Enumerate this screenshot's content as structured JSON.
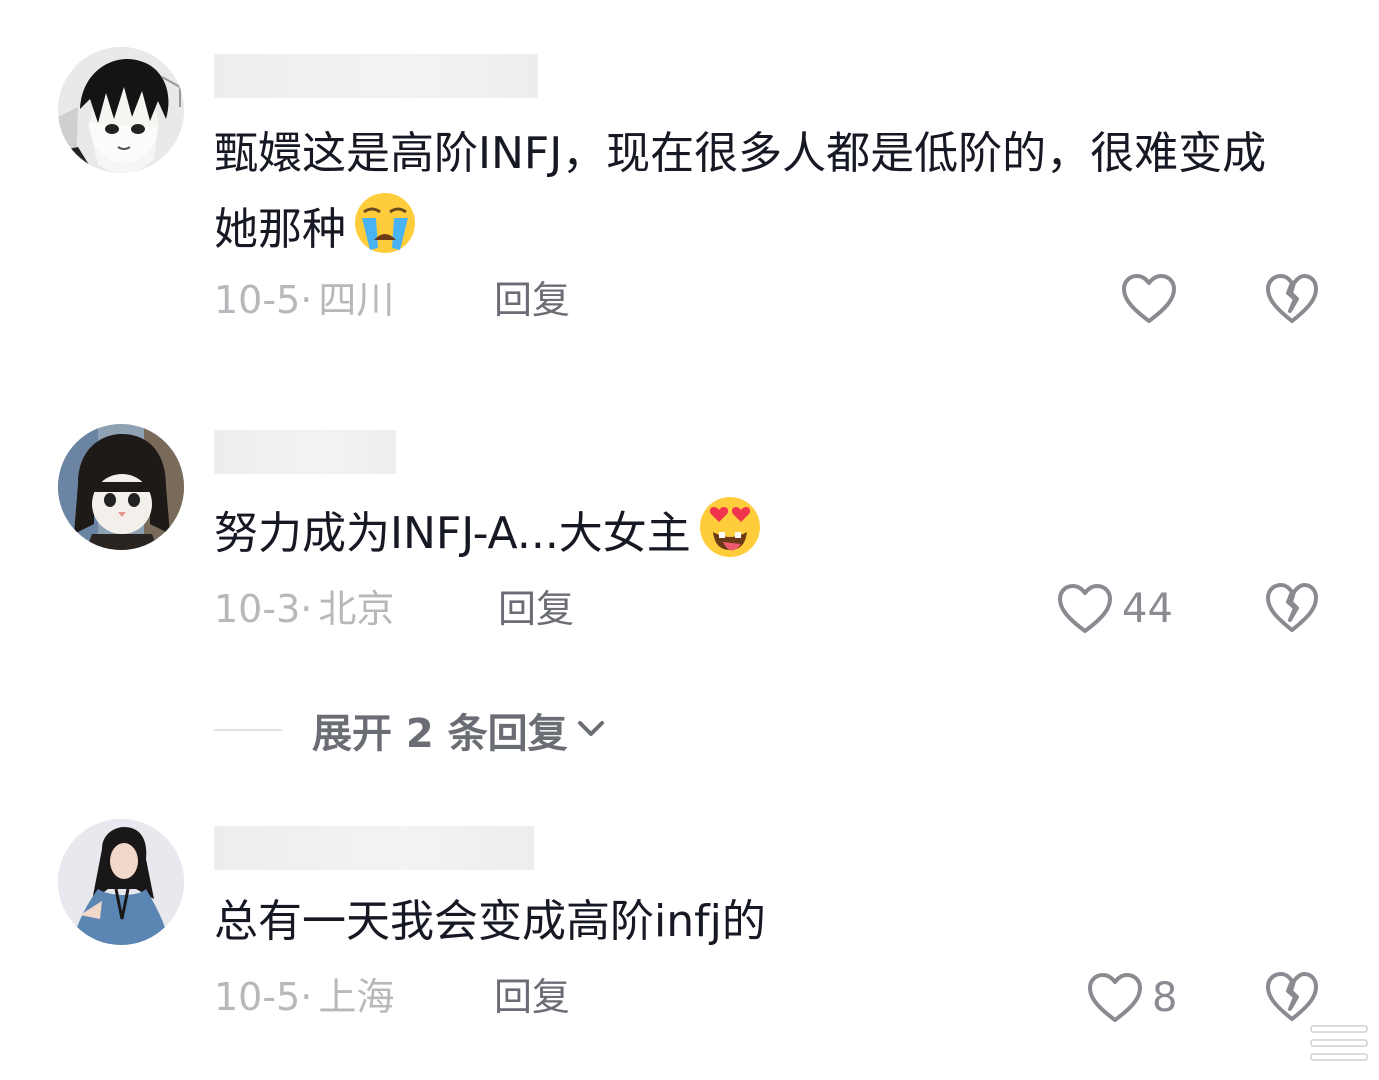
{
  "comments": [
    {
      "text": "甄嬛这是高阶INFJ，现在很多人都是低阶的，很难变成她那种",
      "emoji": "loudly-crying-face",
      "date": "10-5",
      "separator": "·",
      "location": "四川",
      "reply_label": "回复",
      "likes": ""
    },
    {
      "text": "努力成为INFJ-A...大女主",
      "emoji": "heart-eyes-tongue-face",
      "date": "10-3",
      "separator": "·",
      "location": "北京",
      "reply_label": "回复",
      "likes": "44",
      "expand_label": "展开 2 条回复"
    },
    {
      "text": "总有一天我会变成高阶infj的",
      "date": "10-5",
      "separator": "·",
      "location": "上海",
      "reply_label": "回复",
      "likes": "8"
    }
  ],
  "icons": {
    "like": "heart-outline-icon",
    "dislike": "broken-heart-icon",
    "expand": "chevron-down-icon"
  },
  "colors": {
    "text": "#161823",
    "meta": "#b8b8bc",
    "action": "#6b6d74",
    "icon": "#8a8b91"
  }
}
